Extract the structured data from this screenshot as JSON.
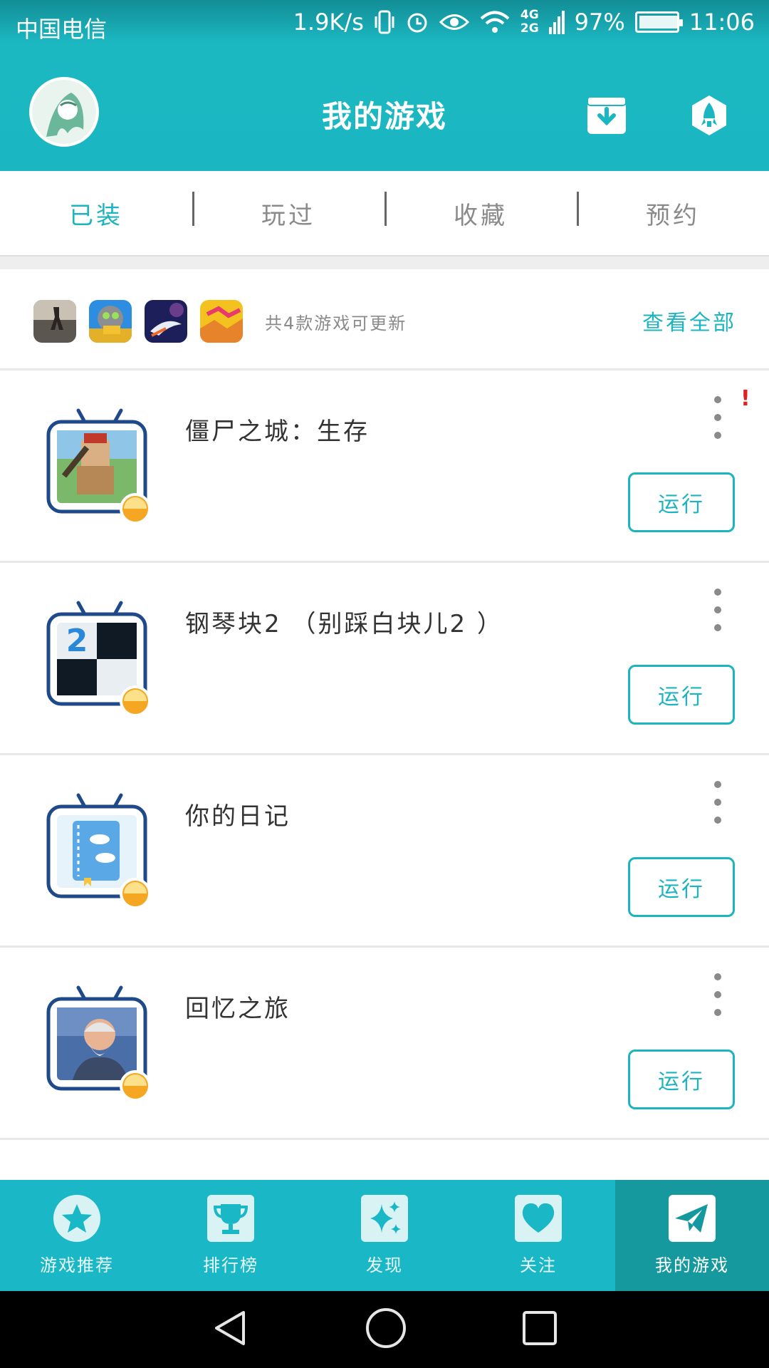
{
  "status_bar": {
    "carrier": "中国电信",
    "speed": "1.9K/s",
    "net_top": "4G",
    "net_bottom": "2G",
    "battery": "97%",
    "time": "11:06"
  },
  "header": {
    "title": "我的游戏"
  },
  "tabs": [
    {
      "label": "已装",
      "active": true
    },
    {
      "label": "玩过",
      "active": false
    },
    {
      "label": "收藏",
      "active": false
    },
    {
      "label": "预约",
      "active": false
    }
  ],
  "updates": {
    "text": "共4款游戏可更新",
    "view_all": "查看全部"
  },
  "games": [
    {
      "name": "僵尸之城：生存",
      "run_label": "运行",
      "alert": "!"
    },
    {
      "name": "钢琴块2 （别踩白块儿2 ）",
      "run_label": "运行"
    },
    {
      "name": "你的日记",
      "run_label": "运行"
    },
    {
      "name": "回忆之旅",
      "run_label": "运行"
    }
  ],
  "bottom_nav": [
    {
      "label": "游戏推荐",
      "icon": "star-icon",
      "active": false
    },
    {
      "label": "排行榜",
      "icon": "trophy-icon",
      "active": false
    },
    {
      "label": "发现",
      "icon": "sparkle-icon",
      "active": false
    },
    {
      "label": "关注",
      "icon": "heart-icon",
      "active": false
    },
    {
      "label": "我的游戏",
      "icon": "paper-plane-icon",
      "active": true
    }
  ],
  "colors": {
    "accent": "#1cb4bf",
    "header": "#1ab7c2",
    "nav_active": "#15999f"
  }
}
